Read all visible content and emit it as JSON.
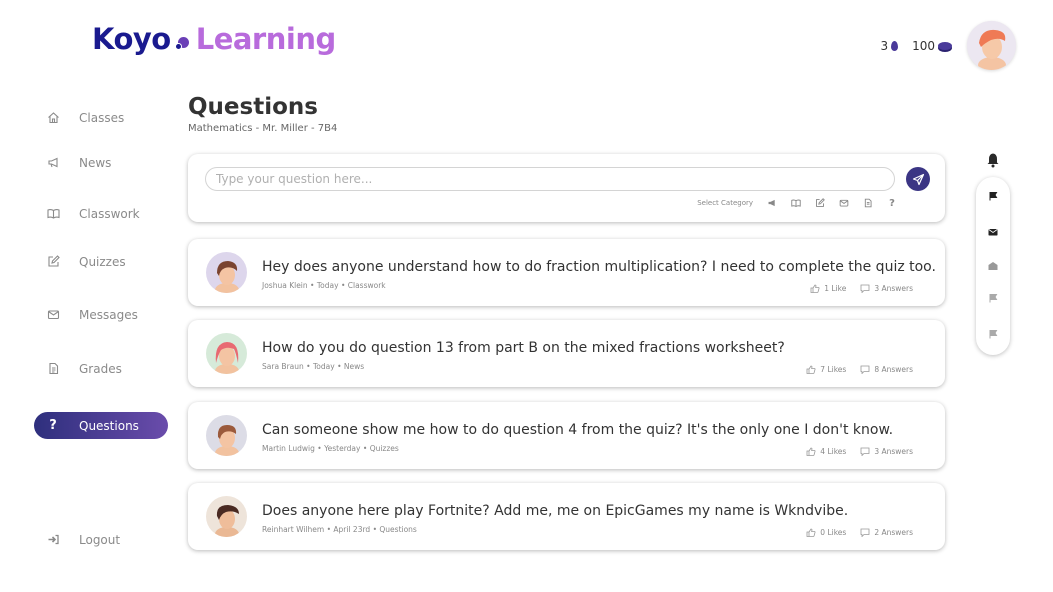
{
  "brand": {
    "part1": "Koyo",
    "part2": "Learning"
  },
  "header": {
    "streak": "3",
    "coins": "100"
  },
  "sidebar": {
    "items": [
      {
        "label": "Classes",
        "icon": "home-icon"
      },
      {
        "label": "News",
        "icon": "megaphone-icon"
      },
      {
        "label": "Classwork",
        "icon": "book-icon"
      },
      {
        "label": "Quizzes",
        "icon": "edit-icon"
      },
      {
        "label": "Messages",
        "icon": "mail-icon"
      },
      {
        "label": "Grades",
        "icon": "document-icon"
      },
      {
        "label": "Questions",
        "icon": "question-icon",
        "active": true
      }
    ],
    "logout": "Logout"
  },
  "page": {
    "title": "Questions",
    "subtitle": "Mathematics - Mr. Miller  - 7B4"
  },
  "ask": {
    "placeholder": "Type your question here...",
    "category_label": "Select Category"
  },
  "questions": [
    {
      "text": "Hey does anyone understand how to do fraction multiplication? I need to complete the quiz too.",
      "author": "Joshua Klein",
      "time": "Today",
      "category": "Classwork",
      "likes": "1 Like",
      "answers": "3 Answers"
    },
    {
      "text": "How do you do question 13 from part B on the mixed fractions worksheet?",
      "author": "Sara Braun",
      "time": "Today",
      "category": "News",
      "likes": "7 Likes",
      "answers": "8 Answers"
    },
    {
      "text": "Can someone show me how to do question 4 from the quiz? It's the only one I don't know.",
      "author": "Martin Ludwig",
      "time": "Yesterday",
      "category": "Quizzes",
      "likes": "4 Likes",
      "answers": "3 Answers"
    },
    {
      "text": "Does anyone here play Fortnite? Add me, me on EpicGames my name is Wkndvibe.",
      "author": "Reinhart Wilhem",
      "time": "April 23rd",
      "category": "Questions",
      "likes": "0 Likes",
      "answers": "2 Answers"
    }
  ],
  "colors": {
    "brand_dark": "#1a1a8f",
    "brand_light": "#b86bdc",
    "accent": "#3b3584"
  }
}
